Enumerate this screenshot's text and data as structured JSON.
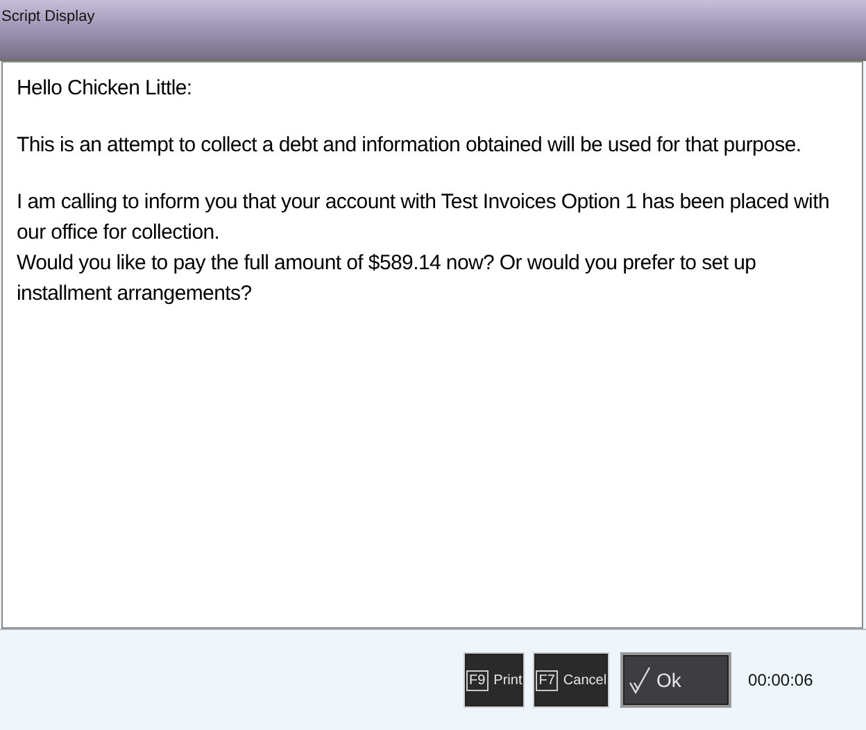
{
  "window": {
    "title": "Script Display"
  },
  "script": [
    "Hello Chicken Little:",
    "This is an attempt to collect a debt and information obtained will be used for that purpose.",
    "I am calling to inform you that your account with Test Invoices Option 1 has been placed with our office for collection.\nWould you like to pay the full amount of $589.14 now? Or would you prefer to set up installment arrangements?"
  ],
  "buttons": [
    {
      "kind": "key",
      "key": "F9",
      "label": "Print"
    },
    {
      "kind": "key",
      "key": "F7",
      "label": "Cancel"
    },
    {
      "kind": "check",
      "label": "Ok"
    }
  ],
  "timer": "00:00:06"
}
